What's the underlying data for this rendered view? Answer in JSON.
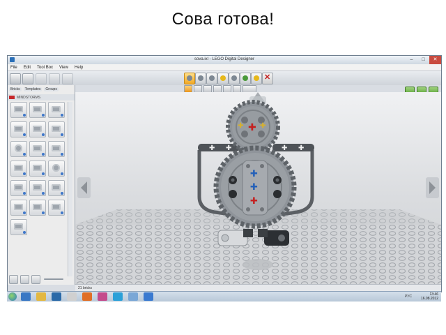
{
  "slide": {
    "title": "Сова готова!"
  },
  "window": {
    "title": "sova.ixl - LEGO Digital Designer",
    "controls": {
      "minimize": "–",
      "maximize": "□",
      "close": "✕"
    }
  },
  "menu": [
    "File",
    "Edit",
    "Tool Box",
    "View",
    "Help"
  ],
  "sidebar": {
    "tabs": [
      "Bricks",
      "Templates",
      "Groups"
    ],
    "header": "MINDSTORMS",
    "tile_icons": [
      "beam-icon",
      "beam-icon",
      "beam-icon",
      "beam-icon",
      "beam-icon",
      "beam-icon",
      "gear-icon",
      "beam-icon",
      "beam-icon",
      "beam-icon",
      "beam-icon",
      "beam-icon",
      "beam-icon",
      "beam-icon",
      "beam-icon",
      "beam-icon",
      "beam-icon",
      "beam-icon",
      "beam-icon"
    ]
  },
  "status": {
    "brick_count": "21 bricks"
  },
  "taskbar": {
    "lang": "РУС",
    "time": "13:46",
    "date": "16.08.2012"
  },
  "colors": {
    "gear_gray": "#8f949a",
    "axle_red": "#c42121",
    "axle_blue": "#2460b8",
    "axle_yellow": "#d8b12a",
    "accent_orange": "#f2a824"
  }
}
